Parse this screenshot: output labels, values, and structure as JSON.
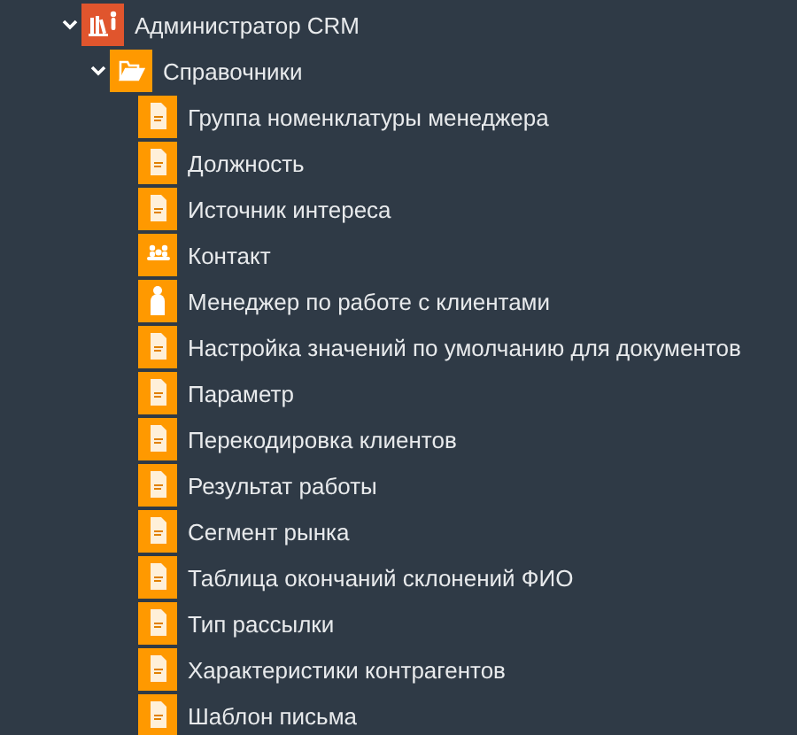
{
  "tree": [
    {
      "label": "Администратор CRM",
      "kind": "admin",
      "expanded": true,
      "children": [
        {
          "label": "Справочники",
          "kind": "folder",
          "expanded": true,
          "children": [
            {
              "label": "Группа номенклатуры менеджера",
              "kind": "document"
            },
            {
              "label": "Должность",
              "kind": "document"
            },
            {
              "label": "Источник интереса",
              "kind": "document"
            },
            {
              "label": "Контакт",
              "kind": "contacts"
            },
            {
              "label": "Менеджер по работе с клиентами",
              "kind": "person"
            },
            {
              "label": "Настройка значений по умолчанию для документов",
              "kind": "document"
            },
            {
              "label": "Параметр",
              "kind": "document"
            },
            {
              "label": "Перекодировка клиентов",
              "kind": "document"
            },
            {
              "label": "Результат работы",
              "kind": "document"
            },
            {
              "label": "Сегмент рынка",
              "kind": "document"
            },
            {
              "label": "Таблица окончаний склонений ФИО",
              "kind": "document"
            },
            {
              "label": "Тип рассылки",
              "kind": "document"
            },
            {
              "label": "Характеристики контрагентов",
              "kind": "document"
            },
            {
              "label": "Шаблон письма",
              "kind": "document"
            }
          ]
        }
      ]
    }
  ]
}
